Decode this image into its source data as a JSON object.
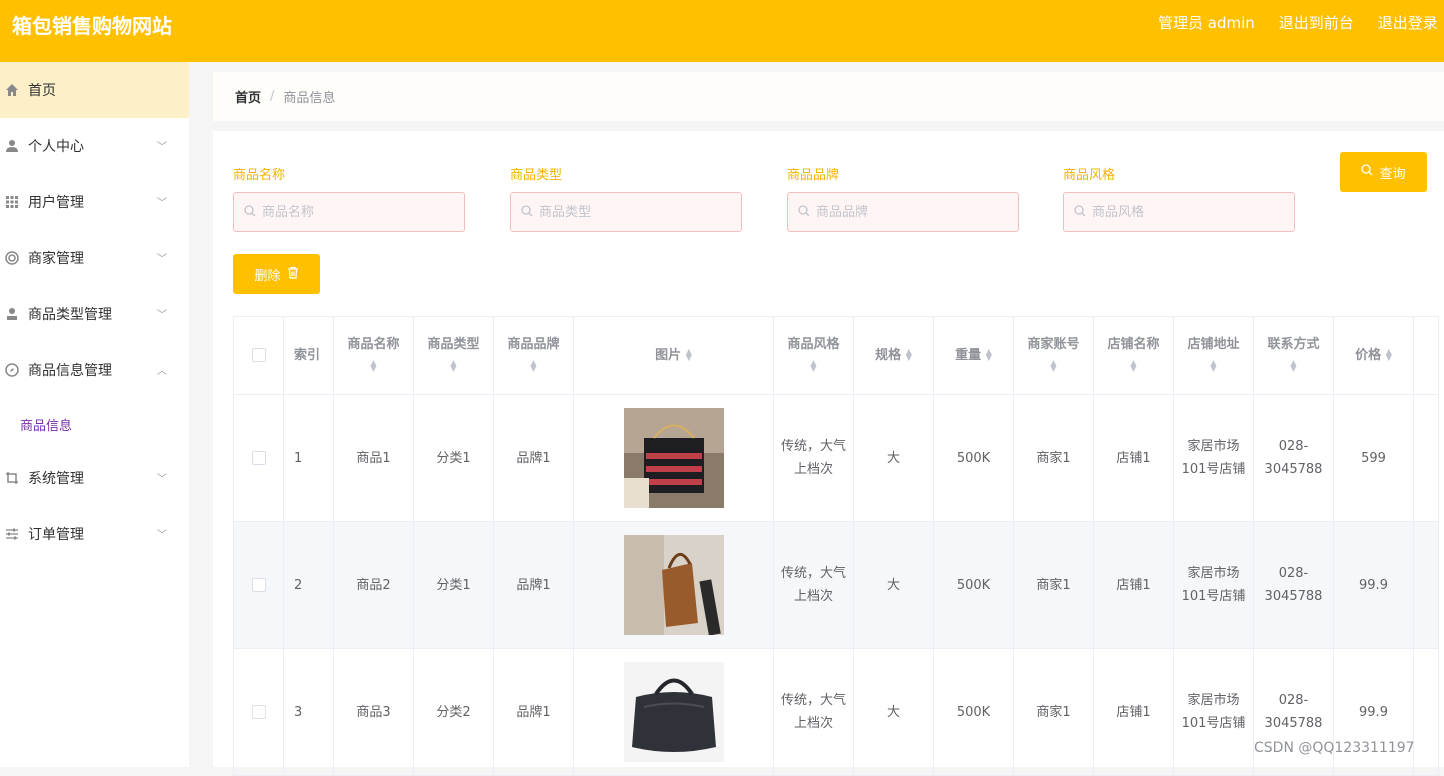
{
  "app": {
    "title": "箱包销售购物网站",
    "admin_label": "管理员 admin",
    "exit_front": "退出到前台",
    "logout": "退出登录"
  },
  "sidebar": {
    "items": [
      {
        "label": "首页",
        "icon": "home-icon"
      },
      {
        "label": "个人中心",
        "icon": "user-icon"
      },
      {
        "label": "用户管理",
        "icon": "grid-icon"
      },
      {
        "label": "商家管理",
        "icon": "lifebuoy-icon"
      },
      {
        "label": "商品类型管理",
        "icon": "person-icon"
      },
      {
        "label": "商品信息管理",
        "icon": "compass-icon"
      },
      {
        "label": "系统管理",
        "icon": "crop-icon"
      },
      {
        "label": "订单管理",
        "icon": "sliders-icon"
      }
    ],
    "sub_item": "商品信息"
  },
  "breadcrumb": {
    "home": "首页",
    "separator": "/",
    "current": "商品信息"
  },
  "filters": [
    {
      "label": "商品名称",
      "placeholder": "商品名称"
    },
    {
      "label": "商品类型",
      "placeholder": "商品类型"
    },
    {
      "label": "商品品牌",
      "placeholder": "商品品牌"
    },
    {
      "label": "商品风格",
      "placeholder": "商品风格"
    }
  ],
  "buttons": {
    "search": "查询",
    "delete": "删除"
  },
  "table": {
    "columns": [
      "索引",
      "商品名称",
      "商品类型",
      "商品品牌",
      "图片",
      "商品风格",
      "规格",
      "重量",
      "商家账号",
      "店铺名称",
      "店铺地址",
      "联系方式",
      "价格"
    ],
    "rows": [
      {
        "index": "1",
        "name": "商品1",
        "type": "分类1",
        "brand": "品牌1",
        "style": "传统，大气上档次",
        "spec": "大",
        "weight": "500K",
        "merchant": "商家1",
        "shop": "店铺1",
        "address": "家居市场101号店铺",
        "contact": "028-3045788",
        "price": "599"
      },
      {
        "index": "2",
        "name": "商品2",
        "type": "分类1",
        "brand": "品牌1",
        "style": "传统，大气上档次",
        "spec": "大",
        "weight": "500K",
        "merchant": "商家1",
        "shop": "店铺1",
        "address": "家居市场101号店铺",
        "contact": "028-3045788",
        "price": "99.9"
      },
      {
        "index": "3",
        "name": "商品3",
        "type": "分类2",
        "brand": "品牌1",
        "style": "传统，大气上档次",
        "spec": "大",
        "weight": "500K",
        "merchant": "商家1",
        "shop": "店铺1",
        "address": "家居市场101号店铺",
        "contact": "028-3045788",
        "price": "99.9"
      }
    ]
  },
  "watermark": "CSDN @QQ123311197",
  "colors": {
    "accent": "#ffc000",
    "active_bg": "#fdf0c8",
    "submenu": "#7b2ca8"
  }
}
